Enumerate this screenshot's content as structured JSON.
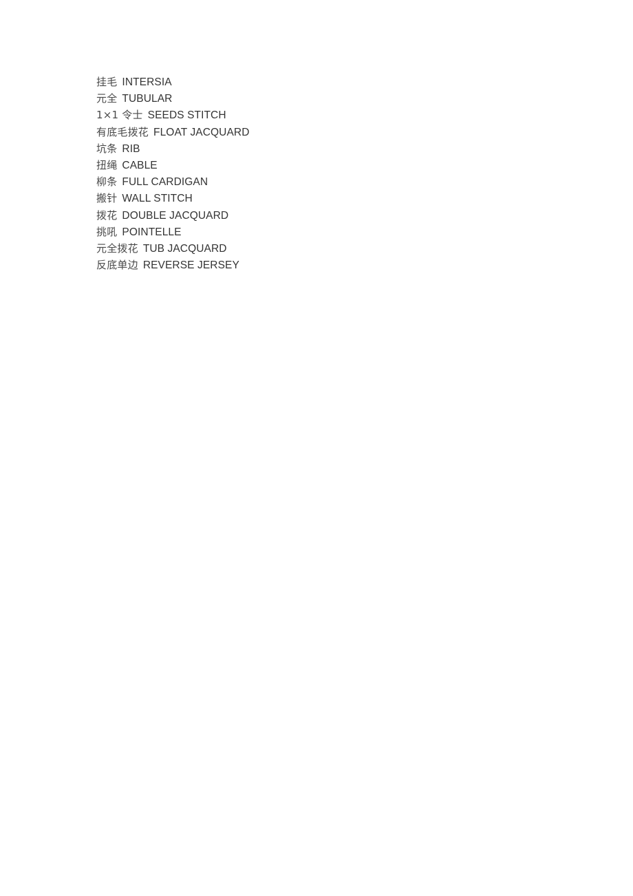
{
  "document": {
    "type": "glossary",
    "background_color": "#ffffff",
    "text_color": "#333333",
    "term_color": "#4a4a4a",
    "entries": [
      {
        "term": "挂毛",
        "definition": "INTERSIA"
      },
      {
        "term": "元全",
        "definition": "TUBULAR"
      },
      {
        "term": "1×1 令士",
        "definition": "SEEDS STITCH"
      },
      {
        "term": "有底毛拨花",
        "definition": "FLOAT JACQUARD"
      },
      {
        "term": "坑条",
        "definition": "RIB"
      },
      {
        "term": "扭绳",
        "definition": "CABLE"
      },
      {
        "term": "柳条",
        "definition": "FULL CARDIGAN"
      },
      {
        "term": "搬针",
        "definition": "WALL STITCH"
      },
      {
        "term": "拨花",
        "definition": "DOUBLE JACQUARD"
      },
      {
        "term": "挑吼",
        "definition": "POINTELLE"
      },
      {
        "term": "元全拨花",
        "definition": "TUB JACQUARD"
      },
      {
        "term": "反底单边",
        "definition": "REVERSE JERSEY"
      }
    ]
  }
}
